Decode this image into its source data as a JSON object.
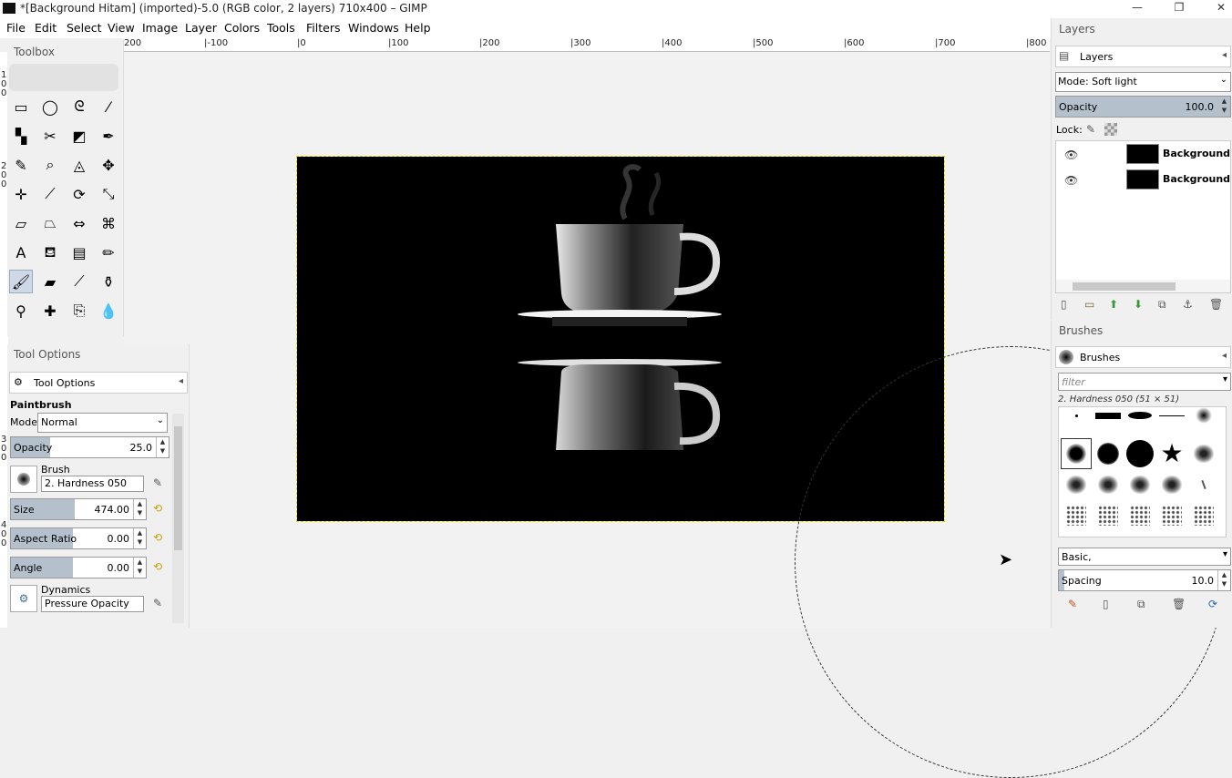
{
  "window": {
    "title": "*[Background Hitam] (imported)-5.0 (RGB color, 2 layers) 710x400 – GIMP",
    "controls": [
      "—",
      "❐",
      "✕"
    ]
  },
  "menu": [
    {
      "label": "File"
    },
    {
      "label": "Edit"
    },
    {
      "label": "Select"
    },
    {
      "label": "View"
    },
    {
      "label": "Image"
    },
    {
      "label": "Layer"
    },
    {
      "label": "Colors"
    },
    {
      "label": "Tools"
    },
    {
      "label": "Filters"
    },
    {
      "label": "Windows"
    },
    {
      "label": "Help"
    }
  ],
  "ruler": {
    "h_ticks": [
      "200",
      "|-100",
      "|0",
      "|100",
      "|200",
      "|300",
      "|400",
      "|500",
      "|600",
      "|700",
      "|800"
    ],
    "v_ticks": [
      "1",
      "0",
      "0",
      "2",
      "0",
      "0",
      "3",
      "0",
      "0",
      "4",
      "0",
      "0"
    ]
  },
  "toolbox": {
    "title": "Toolbox",
    "tools": [
      {
        "name": "rect-select-icon",
        "glyph": "▭"
      },
      {
        "name": "ellipse-select-icon",
        "glyph": "◯"
      },
      {
        "name": "free-select-icon",
        "glyph": "ᘓ"
      },
      {
        "name": "fuzzy-select-icon",
        "glyph": "⁄"
      },
      {
        "name": "color-select-icon",
        "glyph": "▚"
      },
      {
        "name": "scissors-select-icon",
        "glyph": "✂"
      },
      {
        "name": "foreground-select-icon",
        "glyph": "◩"
      },
      {
        "name": "paths-icon",
        "glyph": "✒"
      },
      {
        "name": "color-picker-icon",
        "glyph": "✎"
      },
      {
        "name": "zoom-icon",
        "glyph": "⌕"
      },
      {
        "name": "measure-icon",
        "glyph": "◬"
      },
      {
        "name": "move-icon",
        "glyph": "✥"
      },
      {
        "name": "align-icon",
        "glyph": "✛"
      },
      {
        "name": "crop-icon",
        "glyph": "⟋"
      },
      {
        "name": "rotate-icon",
        "glyph": "⟳"
      },
      {
        "name": "scale-icon",
        "glyph": "⤡"
      },
      {
        "name": "shear-icon",
        "glyph": "▱"
      },
      {
        "name": "perspective-icon",
        "glyph": "⏢"
      },
      {
        "name": "flip-icon",
        "glyph": "⇔"
      },
      {
        "name": "cage-icon",
        "glyph": "⌘"
      },
      {
        "name": "text-icon",
        "glyph": "A"
      },
      {
        "name": "bucket-fill-icon",
        "glyph": "⛾"
      },
      {
        "name": "gradient-icon",
        "glyph": "▤"
      },
      {
        "name": "pencil-icon",
        "glyph": "✏"
      },
      {
        "name": "paintbrush-icon",
        "glyph": "🖌"
      },
      {
        "name": "eraser-icon",
        "glyph": "▰"
      },
      {
        "name": "airbrush-icon",
        "glyph": "⟋"
      },
      {
        "name": "ink-icon",
        "glyph": "⚱"
      },
      {
        "name": "clone-icon",
        "glyph": "⚲"
      },
      {
        "name": "heal-icon",
        "glyph": "✚"
      },
      {
        "name": "perspective-clone-icon",
        "glyph": "⎘"
      },
      {
        "name": "blur-icon",
        "glyph": "💧"
      }
    ]
  },
  "tool_options": {
    "title": "Tool Options",
    "tab_label": "Tool Options",
    "tool_name": "Paintbrush",
    "mode_label": "Mode:",
    "mode_value": "Normal",
    "opacity_label": "Opacity",
    "opacity_value": "25.0",
    "opacity_fraction": 0.25,
    "brush_label": "Brush",
    "brush_value": "2. Hardness 050",
    "size_label": "Size",
    "size_value": "474.00",
    "size_fraction": 0.47,
    "aspect_label": "Aspect Ratio",
    "aspect_value": "0.00",
    "angle_label": "Angle",
    "angle_value": "0.00",
    "dynamics_label": "Dynamics",
    "dynamics_value": "Pressure Opacity"
  },
  "layers": {
    "title": "Layers",
    "tab_label": "Layers",
    "mode_label": "Mode: Soft light",
    "opacity_label": "Opacity",
    "opacity_value": "100.0",
    "lock_label": "Lock:",
    "items": [
      {
        "name": "Background Hit"
      },
      {
        "name": "Background Hit"
      }
    ]
  },
  "brushes": {
    "title": "Brushes",
    "tab_label": "Brushes",
    "filter_placeholder": "filter",
    "selected": "2. Hardness 050 (51 × 51)",
    "preset": "Basic,",
    "spacing_label": "Spacing",
    "spacing_value": "10.0"
  },
  "colors": {
    "accent": "#b4c0cc",
    "canvas_bg": "#000000",
    "selection": "#e6d800"
  }
}
